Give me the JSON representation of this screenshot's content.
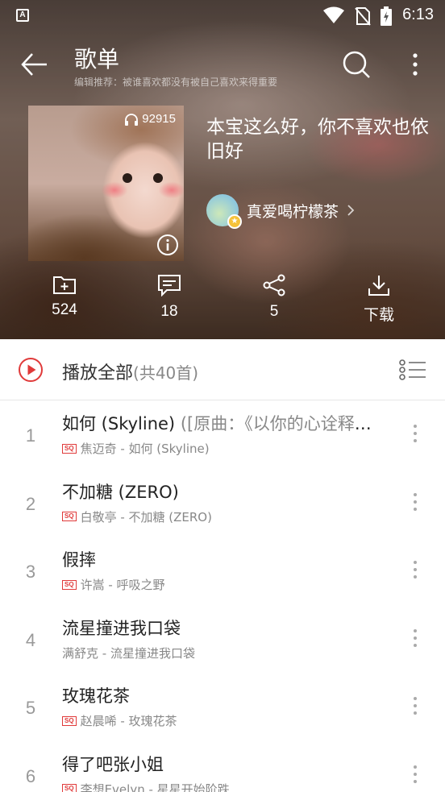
{
  "status_bar": {
    "time": "6:13",
    "app_icon_letter": "A"
  },
  "header": {
    "title": "歌单",
    "subtitle": "编辑推荐：被谁喜欢都没有被自己喜欢来得重要"
  },
  "playlist": {
    "play_count": "92915",
    "name": "本宝这么好，你不喜欢也依旧好",
    "creator": "真爱喝柠檬茶"
  },
  "stats": {
    "favorite_count": "524",
    "comment_count": "18",
    "share_count": "5",
    "download_label": "下载"
  },
  "play_all": {
    "label": "播放全部",
    "count": "(共40首)"
  },
  "songs": [
    {
      "index": "1",
      "title": "如何 (Skyline)",
      "alias": " ([原曲：《以你的心诠释我的爱》])",
      "sq": true,
      "meta": "焦迈奇 - 如何 (Skyline)"
    },
    {
      "index": "2",
      "title": "不加糖 (ZERO)",
      "alias": "",
      "sq": true,
      "meta": "白敬亭 - 不加糖 (ZERO)"
    },
    {
      "index": "3",
      "title": "假摔",
      "alias": "",
      "sq": true,
      "meta": "许嵩 - 呼吸之野"
    },
    {
      "index": "4",
      "title": "流星撞进我口袋",
      "alias": "",
      "sq": false,
      "meta": "满舒克 - 流星撞进我口袋"
    },
    {
      "index": "5",
      "title": "玫瑰花茶",
      "alias": "",
      "sq": true,
      "meta": "赵晨唏 - 玫瑰花茶"
    },
    {
      "index": "6",
      "title": "得了吧张小姐",
      "alias": "",
      "sq": true,
      "meta": "李想Evelyn - 星星开始阶跌"
    }
  ],
  "sq_label": "SQ",
  "colors": {
    "accent": "#e03a3a"
  }
}
